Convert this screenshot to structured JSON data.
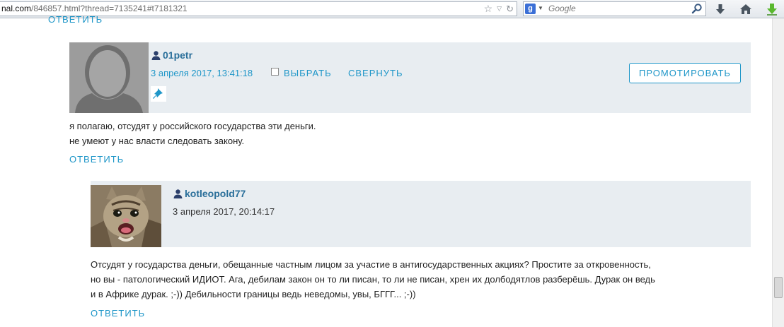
{
  "browser": {
    "url_host": "nal.com",
    "url_rest": "/846857.html?thread=7135241#t7181321",
    "search_placeholder": "Google",
    "search_engine_letter": "g"
  },
  "top_reply_label": "ОТВЕТИТЬ",
  "comments": [
    {
      "username": "01petr",
      "date": "3 апреля 2017, 13:41:18",
      "select_label": "ВЫБРАТЬ",
      "collapse_label": "СВЕРНУТЬ",
      "promote_label": "ПРОМОТИРОВАТЬ",
      "lines": [
        "я полагаю, отсудят у российского государства эти деньги.",
        "не умеют у нас власти следовать закону."
      ],
      "reply_label": "ОТВЕТИТЬ"
    },
    {
      "username": "kotleopold77",
      "date": "3 апреля 2017, 20:14:17",
      "lines": [
        "Отсудят у государства деньги, обещанные частным лицом за участие в антигосударственных акциях? Простите за откровенность,",
        "но вы - патологический ИДИОТ. Ага, дебилам закон он то ли писан, то ли не писан, хрен их долбодятлов разберёшь. Дурак он ведь",
        "и в Африке дурак. ;-)) Дебильности границы ведь неведомы, увы, БГГГ... ;-))"
      ],
      "reply_label": "ОТВЕТИТЬ"
    }
  ],
  "colors": {
    "link": "#1e96c8",
    "username": "#2a6f9a",
    "header_bg": "#e8edf1"
  }
}
